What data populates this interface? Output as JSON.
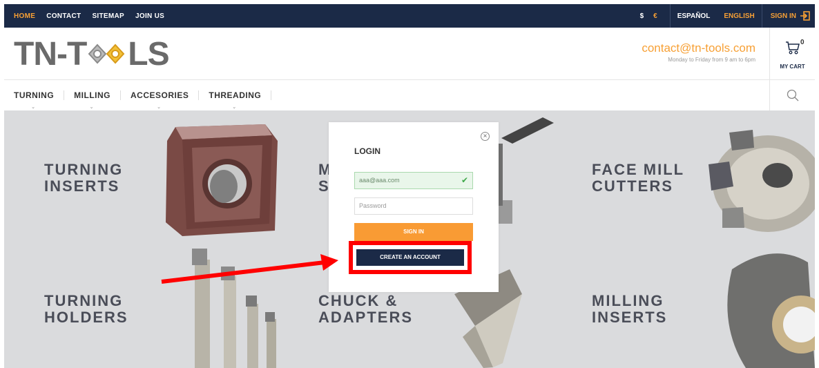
{
  "topbar": {
    "nav": [
      "HOME",
      "CONTACT",
      "SITEMAP",
      "JOIN US"
    ],
    "currency_usd": "$",
    "currency_eur": "€",
    "lang_es": "ESPAÑOL",
    "lang_en": "ENGLISH",
    "signin": "SIGN IN"
  },
  "header": {
    "logo_left": "TN-T",
    "logo_right": "LS",
    "email": "contact@tn-tools.com",
    "hours": "Monday to Friday from 9 am to 6pm",
    "cart_count": "0",
    "cart_label": "MY CART"
  },
  "catnav": [
    "TURNING",
    "MILLING",
    "ACCESORIES",
    "THREADING"
  ],
  "hero": {
    "cat1_l1": "TURNING",
    "cat1_l2": "INSERTS",
    "cat2_l1": "M",
    "cat2_l2": "S",
    "cat3_l1": "FACE MILL",
    "cat3_l2": "CUTTERS",
    "cat4_l1": "TURNING",
    "cat4_l2": "HOLDERS",
    "cat5_l1": "CHUCK &",
    "cat5_l2": "ADAPTERS",
    "cat6_l1": "MILLING",
    "cat6_l2": "INSERTS"
  },
  "modal": {
    "title": "LOGIN",
    "email_value": "aaa@aaa.com",
    "password_placeholder": "Password",
    "signin_label": "SIGN IN",
    "create_label": "CREATE AN ACCOUNT"
  },
  "colors": {
    "navy": "#1b2a47",
    "orange": "#f7a035",
    "annotation": "#ff0000"
  }
}
